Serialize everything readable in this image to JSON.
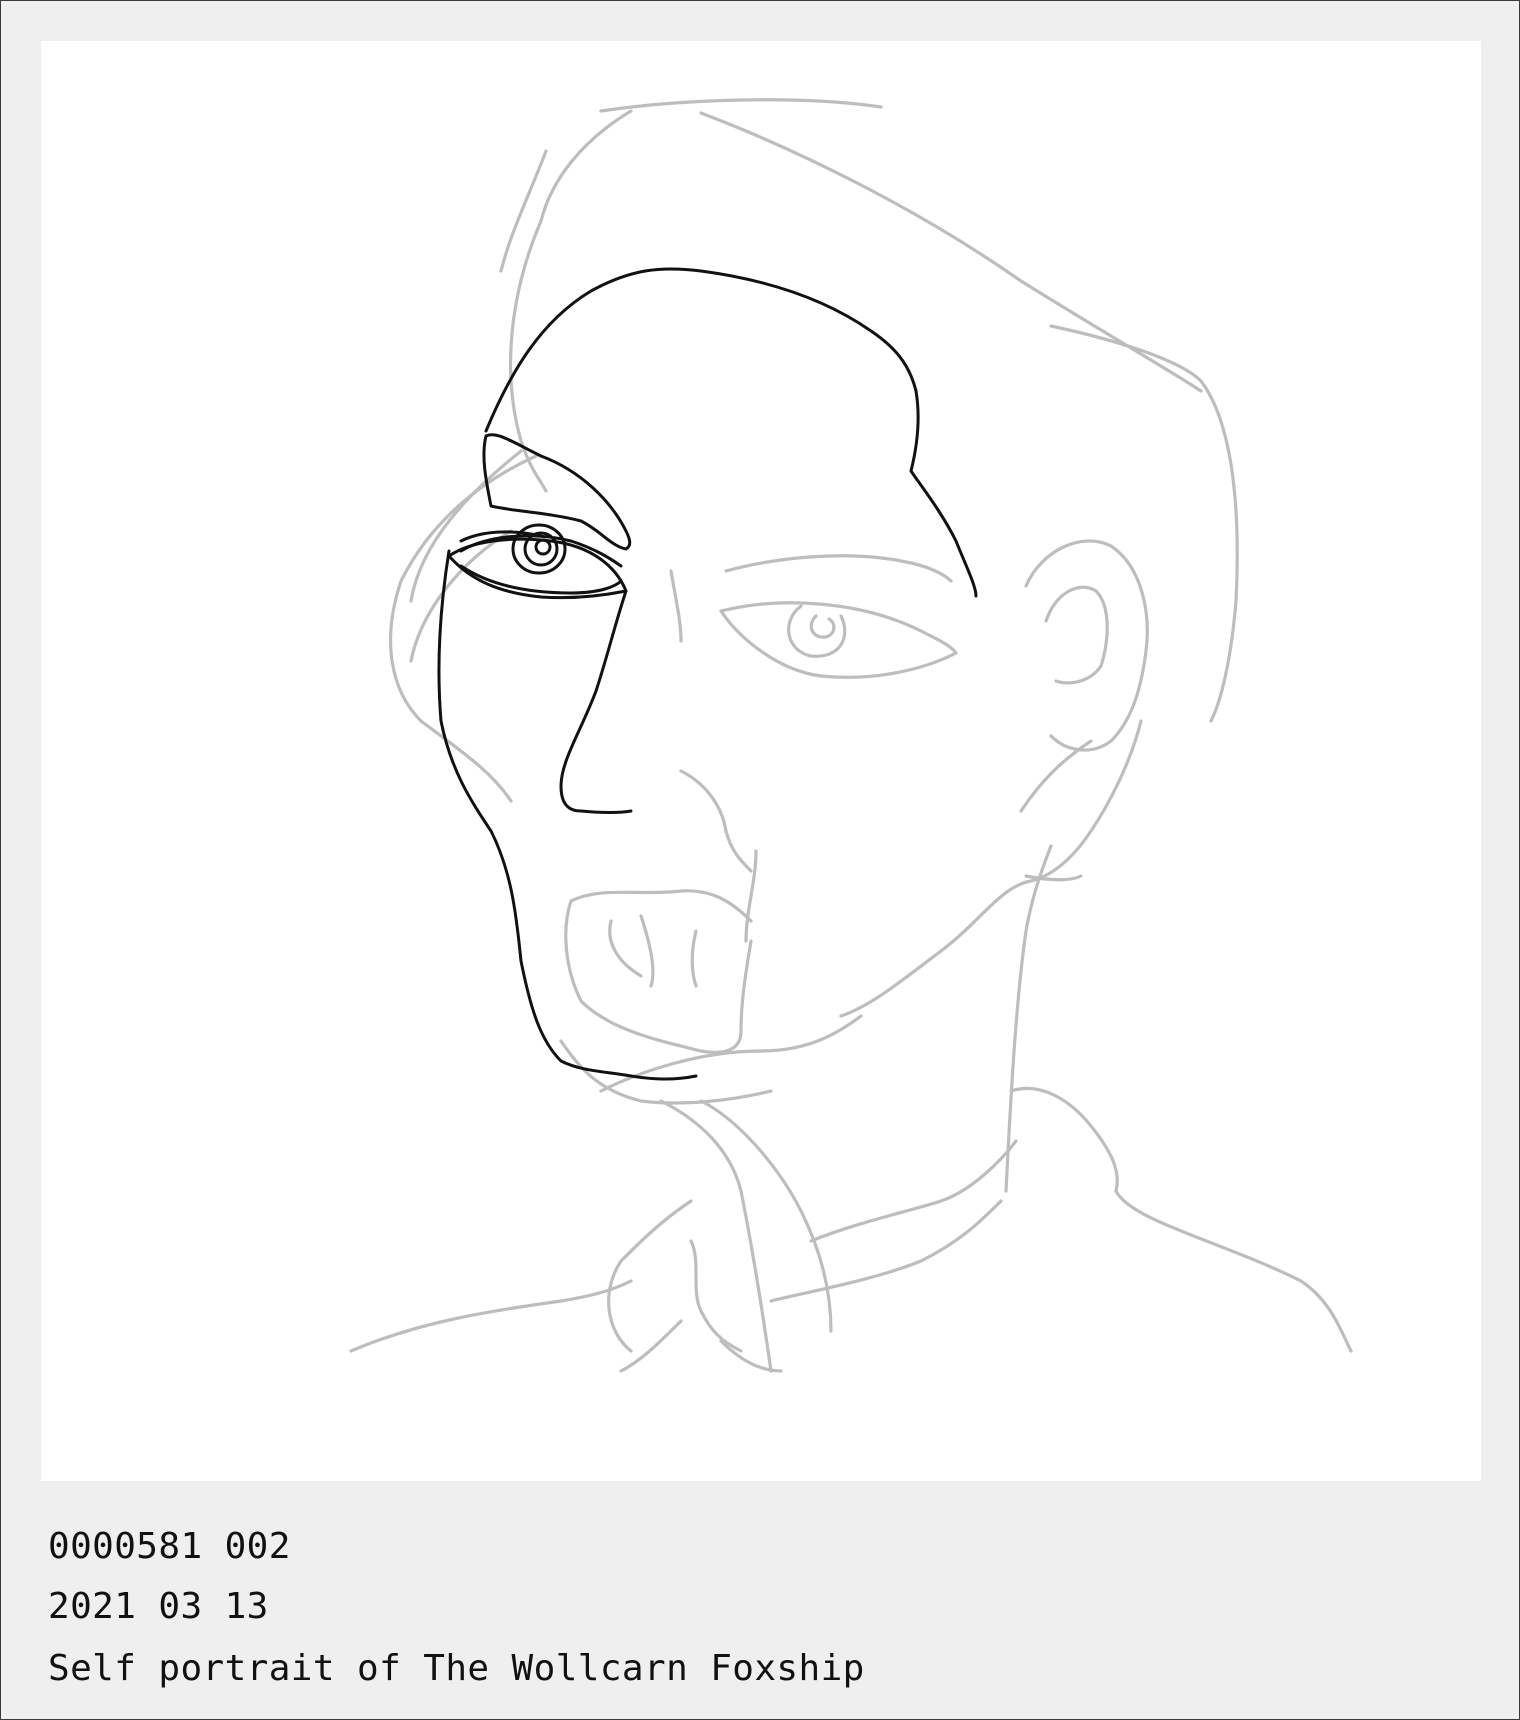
{
  "caption": {
    "id_line": "0000581 002",
    "date_line": "2021 03 13",
    "title_line": "Self portrait of The Wollcarn Foxship"
  },
  "colors": {
    "frame_background": "#efefef",
    "canvas_background": "#ffffff",
    "sketch_light_stroke": "#bdbdbd",
    "sketch_dark_stroke": "#111111",
    "text": "#111111"
  }
}
